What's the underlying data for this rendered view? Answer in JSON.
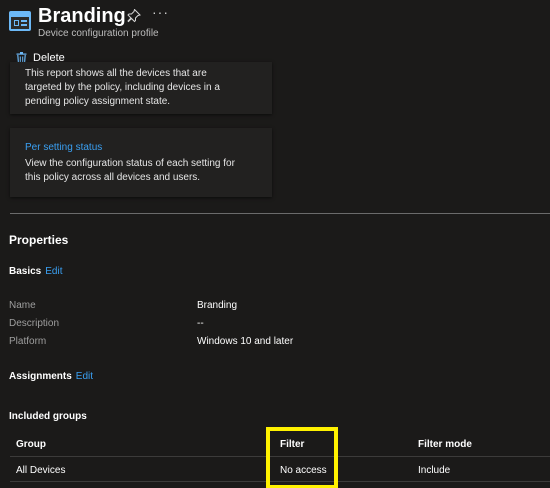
{
  "header": {
    "title": "Branding",
    "subtitle": "Device configuration profile",
    "more": "···"
  },
  "toolbar": {
    "delete_label": "Delete"
  },
  "cards": [
    {
      "text": "This report shows all the devices that are targeted by the policy, including devices in a pending policy assignment state."
    },
    {
      "link": "Per setting status",
      "text": "View the configuration status of each setting for this policy across all devices and users."
    }
  ],
  "properties": {
    "title": "Properties",
    "basics": {
      "label": "Basics",
      "edit": "Edit"
    },
    "rows": [
      {
        "label": "Name",
        "value": "Branding"
      },
      {
        "label": "Description",
        "value": "--"
      },
      {
        "label": "Platform",
        "value": "Windows 10 and later"
      }
    ],
    "assignments": {
      "label": "Assignments",
      "edit": "Edit"
    },
    "included_groups": "Included groups",
    "table": {
      "headers": [
        "Group",
        "Filter",
        "Filter mode"
      ],
      "rows": [
        [
          "All Devices",
          "No access",
          "Include"
        ]
      ]
    }
  },
  "colors": {
    "background": "#1b1a19",
    "accent_link": "#3aa0f3",
    "highlight": "#fff200"
  }
}
